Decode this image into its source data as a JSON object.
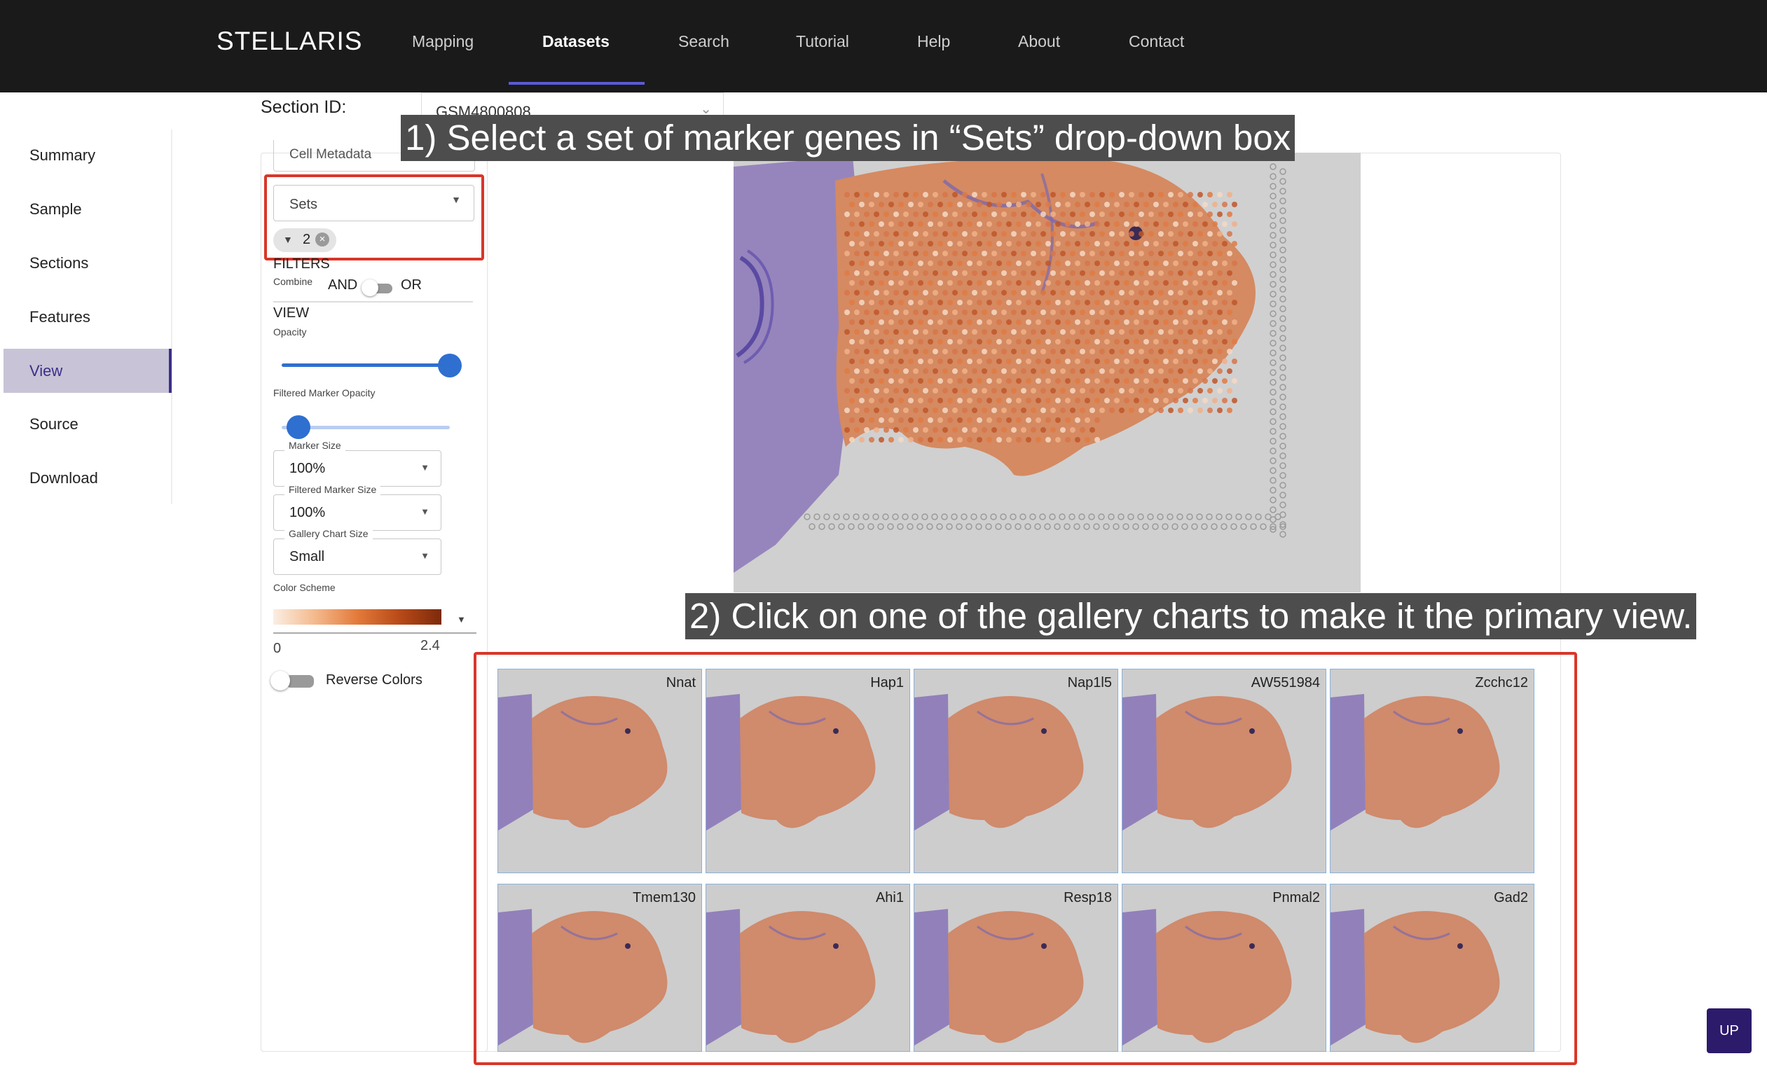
{
  "navbar": {
    "brand": "STELLARIS",
    "items": [
      {
        "label": "Mapping"
      },
      {
        "label": "Datasets"
      },
      {
        "label": "Search"
      },
      {
        "label": "Tutorial"
      },
      {
        "label": "Help"
      },
      {
        "label": "About"
      },
      {
        "label": "Contact"
      }
    ],
    "active": "Datasets"
  },
  "sidebar": {
    "items": [
      {
        "label": "Summary"
      },
      {
        "label": "Sample"
      },
      {
        "label": "Sections"
      },
      {
        "label": "Features"
      },
      {
        "label": "View"
      },
      {
        "label": "Source"
      },
      {
        "label": "Download"
      }
    ],
    "active": "View"
  },
  "section": {
    "label": "Section ID:",
    "value": "GSM4800808"
  },
  "controls": {
    "cell_metadata_label": "Cell Metadata",
    "sets_label": "Sets",
    "sets_chip_value": "2",
    "filters": {
      "heading": "FILTERS",
      "combine_label": "Combine",
      "and_label": "AND",
      "or_label": "OR"
    },
    "view": {
      "heading": "VIEW",
      "opacity_label": "Opacity",
      "opacity_value": 1.0,
      "filtered_marker_opacity_label": "Filtered Marker Opacity",
      "filtered_marker_opacity_value": 0.1,
      "marker_size_label": "Marker Size",
      "marker_size_value": "100%",
      "filtered_marker_size_label": "Filtered Marker Size",
      "filtered_marker_size_value": "100%",
      "gallery_chart_size_label": "Gallery Chart Size",
      "gallery_chart_size_value": "Small",
      "color_scheme_label": "Color Scheme",
      "color_scheme_min": "0",
      "color_scheme_max": "2.4",
      "reverse_colors_label": "Reverse Colors"
    }
  },
  "annotations": {
    "step1": "1) Select a set of marker genes in “Sets” drop-down box",
    "step2": "2) Click on one of the gallery charts to make it the primary view."
  },
  "gallery": {
    "charts": [
      {
        "name": "Nnat"
      },
      {
        "name": "Hap1"
      },
      {
        "name": "Nap1l5"
      },
      {
        "name": "AW551984"
      },
      {
        "name": "Zcchc12"
      },
      {
        "name": "Tmem130"
      },
      {
        "name": "Ahi1"
      },
      {
        "name": "Resp18"
      },
      {
        "name": "Pnmal2"
      },
      {
        "name": "Gad2"
      }
    ]
  },
  "up_button": "UP",
  "colors": {
    "navbar_bg": "#1a1a1a",
    "accent": "#5b5bd6",
    "sidebar_active": "#3b2f8a",
    "annotation_border": "#d9362a",
    "slider": "#2f6fd0"
  }
}
